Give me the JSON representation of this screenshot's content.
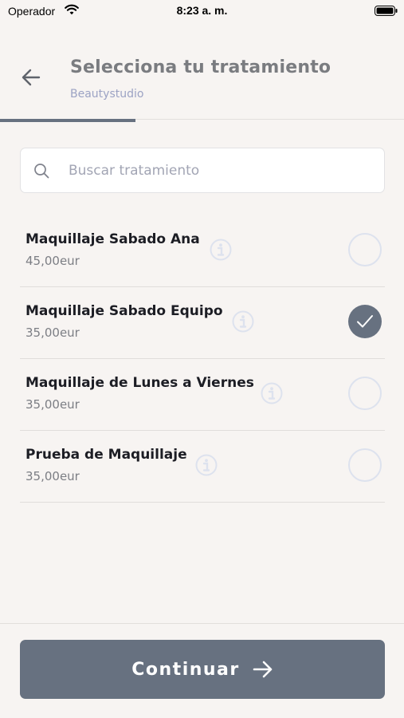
{
  "status_bar": {
    "carrier": "Operador",
    "time": "8:23 a. m."
  },
  "header": {
    "title": "Selecciona tu tratamiento",
    "subtitle": "Beautystudio",
    "progress_fraction": 0.335
  },
  "search": {
    "placeholder": "Buscar tratamiento",
    "value": ""
  },
  "treatments": [
    {
      "name": "Maquillaje Sabado Ana",
      "price": "45,00eur",
      "selected": false
    },
    {
      "name": "Maquillaje Sabado Equipo",
      "price": "35,00eur",
      "selected": true
    },
    {
      "name": "Maquillaje de Lunes a Viernes",
      "price": "35,00eur",
      "selected": false
    },
    {
      "name": "Prueba de Maquillaje",
      "price": "35,00eur",
      "selected": false
    }
  ],
  "footer": {
    "continue_label": "Continuar"
  },
  "colors": {
    "background": "#f7f4f2",
    "accent": "#677180",
    "subtitle": "#9ca3c4",
    "radio_border": "#dde2ee"
  },
  "icons": [
    "wifi-icon",
    "battery-icon",
    "arrow-left-icon",
    "search-icon",
    "info-icon",
    "check-icon",
    "arrow-right-icon"
  ]
}
